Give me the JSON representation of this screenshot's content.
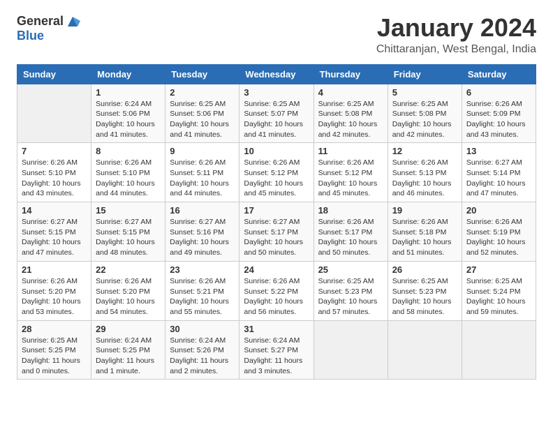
{
  "header": {
    "logo_general": "General",
    "logo_blue": "Blue",
    "title": "January 2024",
    "subtitle": "Chittaranjan, West Bengal, India"
  },
  "columns": [
    "Sunday",
    "Monday",
    "Tuesday",
    "Wednesday",
    "Thursday",
    "Friday",
    "Saturday"
  ],
  "weeks": [
    [
      {
        "day": "",
        "info": ""
      },
      {
        "day": "1",
        "info": "Sunrise: 6:24 AM\nSunset: 5:06 PM\nDaylight: 10 hours\nand 41 minutes."
      },
      {
        "day": "2",
        "info": "Sunrise: 6:25 AM\nSunset: 5:06 PM\nDaylight: 10 hours\nand 41 minutes."
      },
      {
        "day": "3",
        "info": "Sunrise: 6:25 AM\nSunset: 5:07 PM\nDaylight: 10 hours\nand 41 minutes."
      },
      {
        "day": "4",
        "info": "Sunrise: 6:25 AM\nSunset: 5:08 PM\nDaylight: 10 hours\nand 42 minutes."
      },
      {
        "day": "5",
        "info": "Sunrise: 6:25 AM\nSunset: 5:08 PM\nDaylight: 10 hours\nand 42 minutes."
      },
      {
        "day": "6",
        "info": "Sunrise: 6:26 AM\nSunset: 5:09 PM\nDaylight: 10 hours\nand 43 minutes."
      }
    ],
    [
      {
        "day": "7",
        "info": "Sunrise: 6:26 AM\nSunset: 5:10 PM\nDaylight: 10 hours\nand 43 minutes."
      },
      {
        "day": "8",
        "info": "Sunrise: 6:26 AM\nSunset: 5:10 PM\nDaylight: 10 hours\nand 44 minutes."
      },
      {
        "day": "9",
        "info": "Sunrise: 6:26 AM\nSunset: 5:11 PM\nDaylight: 10 hours\nand 44 minutes."
      },
      {
        "day": "10",
        "info": "Sunrise: 6:26 AM\nSunset: 5:12 PM\nDaylight: 10 hours\nand 45 minutes."
      },
      {
        "day": "11",
        "info": "Sunrise: 6:26 AM\nSunset: 5:12 PM\nDaylight: 10 hours\nand 45 minutes."
      },
      {
        "day": "12",
        "info": "Sunrise: 6:26 AM\nSunset: 5:13 PM\nDaylight: 10 hours\nand 46 minutes."
      },
      {
        "day": "13",
        "info": "Sunrise: 6:27 AM\nSunset: 5:14 PM\nDaylight: 10 hours\nand 47 minutes."
      }
    ],
    [
      {
        "day": "14",
        "info": "Sunrise: 6:27 AM\nSunset: 5:15 PM\nDaylight: 10 hours\nand 47 minutes."
      },
      {
        "day": "15",
        "info": "Sunrise: 6:27 AM\nSunset: 5:15 PM\nDaylight: 10 hours\nand 48 minutes."
      },
      {
        "day": "16",
        "info": "Sunrise: 6:27 AM\nSunset: 5:16 PM\nDaylight: 10 hours\nand 49 minutes."
      },
      {
        "day": "17",
        "info": "Sunrise: 6:27 AM\nSunset: 5:17 PM\nDaylight: 10 hours\nand 50 minutes."
      },
      {
        "day": "18",
        "info": "Sunrise: 6:26 AM\nSunset: 5:17 PM\nDaylight: 10 hours\nand 50 minutes."
      },
      {
        "day": "19",
        "info": "Sunrise: 6:26 AM\nSunset: 5:18 PM\nDaylight: 10 hours\nand 51 minutes."
      },
      {
        "day": "20",
        "info": "Sunrise: 6:26 AM\nSunset: 5:19 PM\nDaylight: 10 hours\nand 52 minutes."
      }
    ],
    [
      {
        "day": "21",
        "info": "Sunrise: 6:26 AM\nSunset: 5:20 PM\nDaylight: 10 hours\nand 53 minutes."
      },
      {
        "day": "22",
        "info": "Sunrise: 6:26 AM\nSunset: 5:20 PM\nDaylight: 10 hours\nand 54 minutes."
      },
      {
        "day": "23",
        "info": "Sunrise: 6:26 AM\nSunset: 5:21 PM\nDaylight: 10 hours\nand 55 minutes."
      },
      {
        "day": "24",
        "info": "Sunrise: 6:26 AM\nSunset: 5:22 PM\nDaylight: 10 hours\nand 56 minutes."
      },
      {
        "day": "25",
        "info": "Sunrise: 6:25 AM\nSunset: 5:23 PM\nDaylight: 10 hours\nand 57 minutes."
      },
      {
        "day": "26",
        "info": "Sunrise: 6:25 AM\nSunset: 5:23 PM\nDaylight: 10 hours\nand 58 minutes."
      },
      {
        "day": "27",
        "info": "Sunrise: 6:25 AM\nSunset: 5:24 PM\nDaylight: 10 hours\nand 59 minutes."
      }
    ],
    [
      {
        "day": "28",
        "info": "Sunrise: 6:25 AM\nSunset: 5:25 PM\nDaylight: 11 hours\nand 0 minutes."
      },
      {
        "day": "29",
        "info": "Sunrise: 6:24 AM\nSunset: 5:25 PM\nDaylight: 11 hours\nand 1 minute."
      },
      {
        "day": "30",
        "info": "Sunrise: 6:24 AM\nSunset: 5:26 PM\nDaylight: 11 hours\nand 2 minutes."
      },
      {
        "day": "31",
        "info": "Sunrise: 6:24 AM\nSunset: 5:27 PM\nDaylight: 11 hours\nand 3 minutes."
      },
      {
        "day": "",
        "info": ""
      },
      {
        "day": "",
        "info": ""
      },
      {
        "day": "",
        "info": ""
      }
    ]
  ]
}
